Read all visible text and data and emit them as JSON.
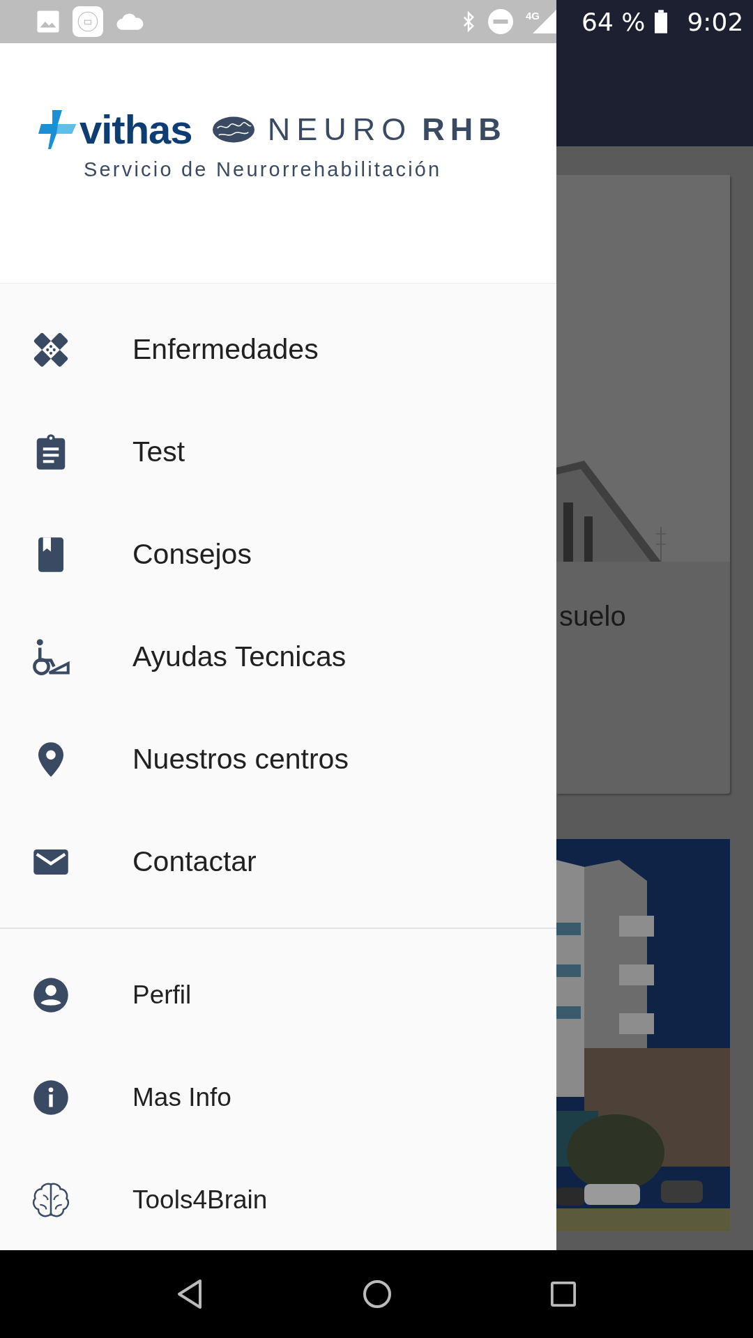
{
  "status_bar": {
    "network": "4G",
    "battery": "64 %",
    "time": "9:02"
  },
  "drawer": {
    "logo": {
      "brand": "vithas",
      "product": "NEURO",
      "product_bold": "RHB",
      "tagline": "Servicio de Neurorrehabilitación"
    },
    "sections": [
      {
        "kind": "primary",
        "items": [
          {
            "label": "Enfermedades"
          },
          {
            "label": "Test"
          },
          {
            "label": "Consejos"
          },
          {
            "label": "Ayudas Tecnicas"
          },
          {
            "label": "Nuestros centros"
          },
          {
            "label": "Contactar"
          }
        ]
      },
      {
        "kind": "secondary",
        "items": [
          {
            "label": "Perfil"
          },
          {
            "label": "Mas Info"
          },
          {
            "label": "Tools4Brain"
          }
        ]
      }
    ]
  },
  "background": {
    "cards": [
      {
        "title": "suelo"
      },
      {
        "kind": "picture"
      }
    ]
  }
}
